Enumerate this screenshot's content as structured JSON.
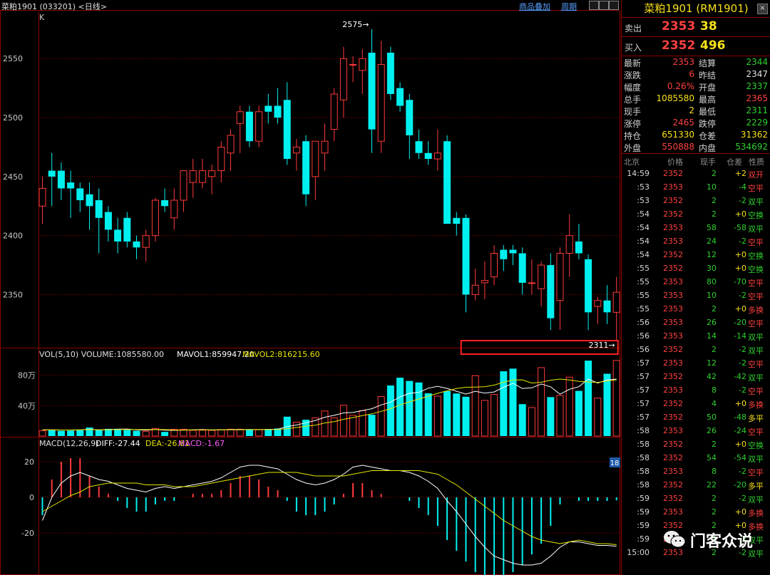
{
  "app": {
    "title": "菜粕1901 (033201) <日线>",
    "links": [
      "商品叠加",
      "周期"
    ]
  },
  "colors": {
    "up": "#ff3a3a",
    "down": "#00f0f0",
    "grid": "#8c0000",
    "label": "#c8c8c8",
    "white_line": "#ffffff",
    "yellow_line": "#e6e600"
  },
  "price_panel": {
    "type_label": "K",
    "yticks": [
      2550,
      2500,
      2450,
      2400,
      2350
    ],
    "high_marker": "2575→",
    "low_marker": "2311→"
  },
  "volume_panel": {
    "label_vol": "VOL(5,10) VOLUME:1085580.00",
    "label_m1": "MAVOL1:859947.20",
    "label_m2": "MAVOL2:816215.60",
    "yticks": [
      "80万",
      "40万"
    ]
  },
  "macd_panel": {
    "label_head": "MACD(12,26,9)",
    "label_diff": "DIFF:-27.44",
    "label_dea": "DEA:-26.61",
    "label_macd": "MACD:-1.67",
    "yticks": [
      "20",
      "0",
      "-20"
    ],
    "right_badge": "18"
  },
  "chart_data": {
    "type": "candlestick",
    "ohlc": [
      [
        2425,
        2450,
        2410,
        2440
      ],
      [
        2455,
        2470,
        2425,
        2450
      ],
      [
        2455,
        2462,
        2430,
        2440
      ],
      [
        2445,
        2455,
        2415,
        2440
      ],
      [
        2440,
        2445,
        2420,
        2430
      ],
      [
        2435,
        2445,
        2405,
        2425
      ],
      [
        2430,
        2440,
        2385,
        2415
      ],
      [
        2420,
        2425,
        2395,
        2405
      ],
      [
        2405,
        2415,
        2385,
        2395
      ],
      [
        2415,
        2420,
        2390,
        2395
      ],
      [
        2395,
        2400,
        2380,
        2390
      ],
      [
        2390,
        2405,
        2378,
        2400
      ],
      [
        2400,
        2432,
        2395,
        2430
      ],
      [
        2430,
        2440,
        2420,
        2425
      ],
      [
        2415,
        2440,
        2405,
        2430
      ],
      [
        2430,
        2455,
        2420,
        2455
      ],
      [
        2445,
        2465,
        2432,
        2455
      ],
      [
        2445,
        2465,
        2440,
        2455
      ],
      [
        2450,
        2460,
        2435,
        2455
      ],
      [
        2455,
        2480,
        2445,
        2475
      ],
      [
        2470,
        2490,
        2455,
        2485
      ],
      [
        2495,
        2510,
        2470,
        2505
      ],
      [
        2505,
        2510,
        2475,
        2480
      ],
      [
        2480,
        2510,
        2475,
        2505
      ],
      [
        2510,
        2520,
        2495,
        2505
      ],
      [
        2510,
        2525,
        2495,
        2500
      ],
      [
        2515,
        2530,
        2460,
        2465
      ],
      [
        2470,
        2482,
        2455,
        2475
      ],
      [
        2480,
        2485,
        2425,
        2435
      ],
      [
        2450,
        2480,
        2430,
        2480
      ],
      [
        2470,
        2495,
        2455,
        2480
      ],
      [
        2490,
        2525,
        2480,
        2520
      ],
      [
        2515,
        2560,
        2500,
        2550
      ],
      [
        2545,
        2552,
        2530,
        2545
      ],
      [
        2540,
        2558,
        2520,
        2550
      ],
      [
        2555,
        2575,
        2470,
        2490
      ],
      [
        2480,
        2565,
        2470,
        2545
      ],
      [
        2555,
        2560,
        2515,
        2520
      ],
      [
        2525,
        2530,
        2505,
        2510
      ],
      [
        2515,
        2520,
        2465,
        2485
      ],
      [
        2480,
        2490,
        2465,
        2470
      ],
      [
        2470,
        2480,
        2460,
        2465
      ],
      [
        2465,
        2490,
        2455,
        2470
      ],
      [
        2480,
        2485,
        2410,
        2410
      ],
      [
        2415,
        2420,
        2400,
        2410
      ],
      [
        2415,
        2418,
        2335,
        2350
      ],
      [
        2350,
        2372,
        2345,
        2358
      ],
      [
        2360,
        2378,
        2346,
        2362
      ],
      [
        2365,
        2392,
        2358,
        2385
      ],
      [
        2388,
        2392,
        2370,
        2380
      ],
      [
        2388,
        2392,
        2375,
        2385
      ],
      [
        2385,
        2390,
        2350,
        2360
      ],
      [
        2360,
        2380,
        2350,
        2360
      ],
      [
        2355,
        2378,
        2340,
        2375
      ],
      [
        2375,
        2385,
        2320,
        2330
      ],
      [
        2345,
        2390,
        2320,
        2385
      ],
      [
        2385,
        2418,
        2365,
        2400
      ],
      [
        2395,
        2410,
        2380,
        2385
      ],
      [
        2380,
        2384,
        2320,
        2335
      ],
      [
        2340,
        2348,
        2325,
        2345
      ],
      [
        2345,
        2358,
        2325,
        2335
      ],
      [
        2335,
        2365,
        2311,
        2352
      ]
    ],
    "volume": [
      28,
      30,
      28,
      29,
      31,
      45,
      32,
      38,
      38,
      32,
      28,
      25,
      40,
      22,
      36,
      36,
      30,
      31,
      30,
      34,
      36,
      36,
      34,
      33,
      37,
      40,
      102,
      73,
      86,
      96,
      132,
      96,
      162,
      109,
      134,
      112,
      208,
      266,
      307,
      290,
      282,
      225,
      210,
      237,
      224,
      207,
      318,
      188,
      219,
      341,
      355,
      168,
      150,
      360,
      205,
      214,
      310,
      238,
      397,
      200,
      328,
      398
    ],
    "ma": {
      "vol_mavol1": [
        33,
        33,
        32,
        32,
        33,
        36,
        33,
        34,
        36,
        37,
        33,
        31,
        34,
        31,
        30,
        32,
        33,
        35,
        32,
        33,
        34,
        34,
        35,
        34,
        35,
        36,
        50,
        58,
        70,
        82,
        99,
        109,
        122,
        124,
        134,
        144,
        164,
        179,
        206,
        225,
        230,
        252,
        262,
        251,
        236,
        221,
        236,
        226,
        232,
        257,
        278,
        250,
        254,
        274,
        259,
        220,
        246,
        260,
        300,
        279,
        295,
        300
      ],
      "vol_mavol2": [
        33,
        33,
        32,
        32,
        33,
        34,
        33,
        33,
        34,
        35,
        34,
        34,
        35,
        34,
        32,
        31,
        33,
        33,
        33,
        33,
        33,
        33,
        34,
        34,
        34,
        35,
        39,
        45,
        52,
        57,
        69,
        76,
        88,
        97,
        108,
        117,
        130,
        144,
        164,
        180,
        195,
        210,
        225,
        238,
        250,
        257,
        258,
        260,
        268,
        283,
        295,
        296,
        279,
        283,
        294,
        300,
        295,
        288,
        285,
        282,
        290,
        296
      ],
      "diff": [
        -13,
        0,
        8,
        12,
        14,
        12,
        10,
        9,
        7,
        5,
        4,
        3,
        5,
        6,
        5,
        6,
        7,
        8,
        9,
        11,
        14,
        17,
        18,
        18,
        17,
        16,
        13,
        10,
        8,
        7,
        8,
        10,
        13,
        17,
        18,
        17,
        16,
        15,
        15,
        14,
        12,
        9,
        5,
        -2,
        -8,
        -15,
        -22,
        -28,
        -33,
        -35,
        -37,
        -38,
        -38,
        -37,
        -33,
        -28,
        -25,
        -25,
        -26,
        -27,
        -27,
        -27.44
      ],
      "dea": [
        -8,
        -5,
        -2,
        1,
        3,
        6,
        7,
        8,
        8,
        8,
        8,
        7,
        7,
        7,
        6,
        6,
        6,
        7,
        8,
        9,
        10,
        11,
        12,
        13,
        14,
        14,
        14,
        14,
        13,
        12,
        12,
        12,
        12,
        13,
        14,
        15,
        15,
        15,
        15,
        15,
        15,
        14,
        13,
        10,
        7,
        3,
        -1,
        -5,
        -9,
        -13,
        -16,
        -19,
        -22,
        -24,
        -25,
        -26,
        -25,
        -24,
        -25,
        -26,
        -26,
        -26.61
      ]
    }
  },
  "right_panel": {
    "title": "菜粕1901 (RM1901)",
    "close_glyph": "×",
    "sell": {
      "label": "卖出",
      "price": "2353",
      "vol": "38"
    },
    "buy": {
      "label": "买入",
      "price": "2352",
      "vol": "496"
    },
    "quotes": [
      {
        "l1": "最新",
        "v1": "2353",
        "c1": "#ff4040",
        "l2": "结算",
        "v2": "2344",
        "c2": "#30d030"
      },
      {
        "l1": "涨跌",
        "v1": "6",
        "c1": "#ff4040",
        "l2": "昨结",
        "v2": "2347",
        "c2": "#e0e0e0"
      },
      {
        "l1": "幅度",
        "v1": "0.26%",
        "c1": "#ff4040",
        "l2": "开盘",
        "v2": "2337",
        "c2": "#30d030"
      },
      {
        "l1": "总手",
        "v1": "1085580",
        "c1": "#f7e01a",
        "l2": "最高",
        "v2": "2365",
        "c2": "#ff4040"
      },
      {
        "l1": "现手",
        "v1": "2",
        "c1": "#f7e01a",
        "l2": "最低",
        "v2": "2311",
        "c2": "#30d030"
      },
      {
        "l1": "涨停",
        "v1": "2465",
        "c1": "#ff4040",
        "l2": "跌停",
        "v2": "2229",
        "c2": "#30d030"
      },
      {
        "l1": "持仓",
        "v1": "651330",
        "c1": "#f7e01a",
        "l2": "仓差",
        "v2": "31362",
        "c2": "#f7e01a"
      },
      {
        "l1": "外盘",
        "v1": "550888",
        "c1": "#ff4040",
        "l2": "内盘",
        "v2": "534692",
        "c2": "#30d030"
      }
    ],
    "ticks_header": [
      "北京",
      "价格",
      "现手",
      "仓差",
      "性质"
    ],
    "ticks": [
      [
        "14:59",
        "2352",
        "2",
        "+2",
        "双开"
      ],
      [
        ":53",
        "2353",
        "10",
        "-4",
        "空平"
      ],
      [
        ":53",
        "2352",
        "2",
        "-2",
        "双平"
      ],
      [
        ":54",
        "2352",
        "2",
        "+0",
        "空换"
      ],
      [
        ":54",
        "2353",
        "58",
        "-58",
        "双平"
      ],
      [
        ":54",
        "2353",
        "24",
        "-2",
        "空平"
      ],
      [
        ":54",
        "2352",
        "12",
        "+0",
        "空换"
      ],
      [
        ":55",
        "2352",
        "30",
        "+0",
        "空换"
      ],
      [
        ":55",
        "2353",
        "80",
        "-70",
        "空平"
      ],
      [
        ":55",
        "2353",
        "10",
        "-2",
        "空平"
      ],
      [
        ":55",
        "2353",
        "2",
        "+0",
        "多换"
      ],
      [
        ":56",
        "2353",
        "26",
        "-20",
        "空平"
      ],
      [
        ":56",
        "2353",
        "14",
        "-14",
        "双平"
      ],
      [
        ":56",
        "2352",
        "2",
        "-2",
        "双平"
      ],
      [
        ":57",
        "2353",
        "12",
        "-2",
        "空平"
      ],
      [
        ":57",
        "2352",
        "42",
        "-42",
        "双平"
      ],
      [
        ":57",
        "2353",
        "8",
        "-2",
        "空平"
      ],
      [
        ":57",
        "2352",
        "4",
        "+0",
        "多换"
      ],
      [
        ":57",
        "2352",
        "50",
        "-48",
        "多平"
      ],
      [
        ":58",
        "2353",
        "26",
        "-24",
        "空平"
      ],
      [
        ":58",
        "2352",
        "2",
        "+0",
        "空换"
      ],
      [
        ":58",
        "2352",
        "54",
        "-54",
        "双平"
      ],
      [
        ":58",
        "2353",
        "8",
        "-2",
        "空平"
      ],
      [
        ":58",
        "2352",
        "22",
        "-20",
        "多平"
      ],
      [
        ":59",
        "2352",
        "2",
        "-2",
        "双平"
      ],
      [
        ":59",
        "2353",
        "2",
        "+0",
        "多换"
      ],
      [
        ":59",
        "2352",
        "2",
        "+0",
        "多换"
      ],
      [
        ":59",
        "2353",
        "2",
        "-2",
        "双平"
      ],
      [
        "15:00",
        "2353",
        "2",
        "-2",
        "双平"
      ]
    ],
    "watermark": "门客众说"
  }
}
